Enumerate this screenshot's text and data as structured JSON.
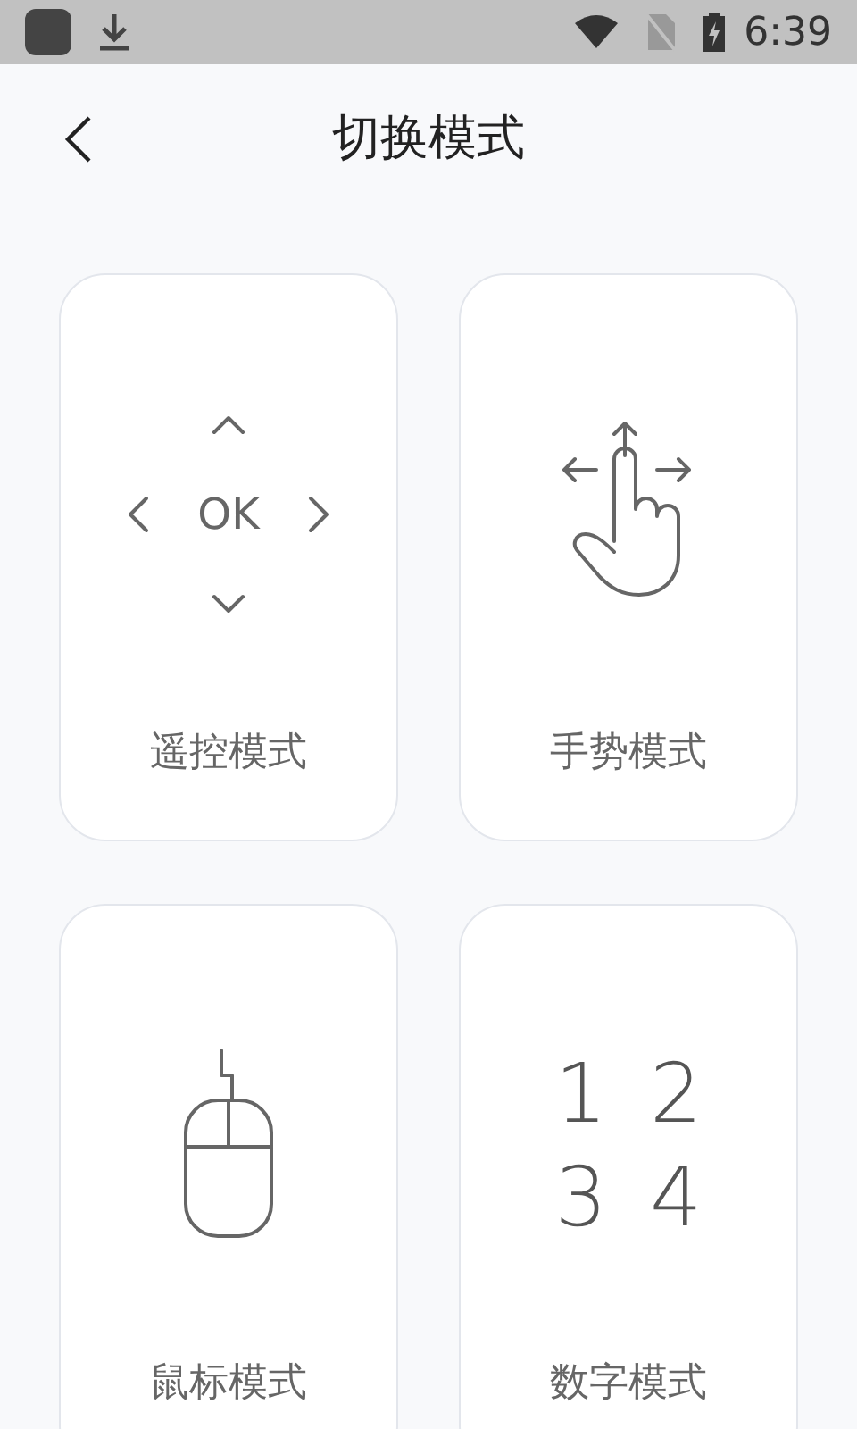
{
  "status_bar": {
    "time": "6:39"
  },
  "header": {
    "title": "切换模式"
  },
  "modes": [
    {
      "kind": "remote",
      "label": "遥控模式",
      "center": "OK"
    },
    {
      "kind": "gesture",
      "label": "手势模式"
    },
    {
      "kind": "mouse",
      "label": "鼠标模式"
    },
    {
      "kind": "numeric",
      "label": "数字模式",
      "digits": [
        [
          "1",
          "2"
        ],
        [
          "3",
          "4"
        ]
      ]
    }
  ]
}
